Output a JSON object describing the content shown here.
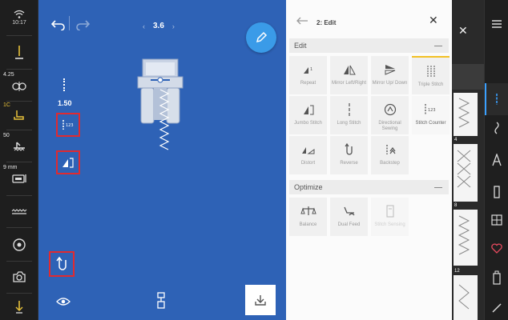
{
  "left_bar": {
    "status_time": "10:17",
    "thread_tension": "4.25",
    "foot_pressure_label": "1C",
    "feed_value": "50",
    "width_value": "9 mm"
  },
  "stitch": {
    "width": "3.6",
    "length": "1.50"
  },
  "panel": {
    "title": "2: Edit",
    "edit_section": "Edit",
    "edit_tiles": [
      {
        "label": "Repeat"
      },
      {
        "label": "Mirror Left/Right"
      },
      {
        "label": "Mirror Up/ Down"
      },
      {
        "label": "Triple Stitch"
      },
      {
        "label": "Jumbo Stitch"
      },
      {
        "label": "Long Stitch"
      },
      {
        "label": "Directional Sewing"
      },
      {
        "label": "Stitch Counter"
      },
      {
        "label": "Distort"
      },
      {
        "label": "Reverse"
      },
      {
        "label": "Backstep"
      }
    ],
    "optimize_section": "Optimize",
    "optimize_tiles": [
      {
        "label": "Balance"
      },
      {
        "label": "Dual Feed"
      },
      {
        "label": "Stitch Sensing"
      }
    ]
  },
  "right_panel": {
    "card_numbers": [
      "4",
      "8",
      "12"
    ]
  },
  "colors": {
    "canvas_blue": "#2e62b6",
    "highlight_red": "#e02a30",
    "accent_yellow": "#f2c024",
    "fab_blue": "#3a9be8"
  }
}
